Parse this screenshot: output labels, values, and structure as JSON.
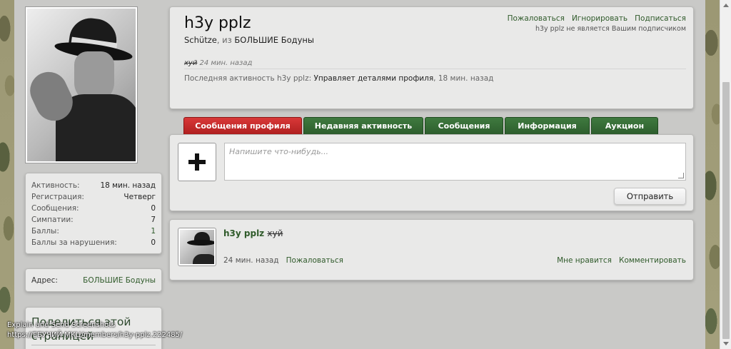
{
  "profile": {
    "username": "h3y pplz",
    "title": "Schütze",
    "from_word": ", из",
    "location": "БОЛЬШИЕ Бодуны",
    "status_text": "хуй",
    "status_time": "24 мин. назад",
    "last_activity_label": "Последняя активность h3y pplz:",
    "last_activity_action": "Управляет деталями профиля",
    "last_activity_time": ", 18 мин. назад",
    "links": {
      "report": "Пожаловаться",
      "ignore": "Игнорировать",
      "follow": "Подписаться"
    },
    "follow_note": "h3y pplz не является Вашим подписчиком"
  },
  "sidebar": {
    "stats": [
      {
        "label": "Активность:",
        "value": "18 мин. назад"
      },
      {
        "label": "Регистрация:",
        "value": "Четверг"
      },
      {
        "label": "Сообщения:",
        "value": "0"
      },
      {
        "label": "Симпатии:",
        "value": "7"
      },
      {
        "label": "Баллы:",
        "value": "1"
      },
      {
        "label": "Баллы за нарушения:",
        "value": "0"
      }
    ],
    "address_label": "Адрес:",
    "address_value": "БОЛЬШИЕ Бодуны",
    "share_title": "Поделиться этой страницей"
  },
  "tabs": [
    {
      "label": "Сообщения профиля",
      "active": true
    },
    {
      "label": "Недавняя активность",
      "active": false
    },
    {
      "label": "Сообщения",
      "active": false
    },
    {
      "label": "Информация",
      "active": false
    },
    {
      "label": "Аукцион",
      "active": false
    }
  ],
  "post_form": {
    "placeholder": "Напишите что-нибудь...",
    "submit_label": "Отправить"
  },
  "message": {
    "author": "h3y pplz",
    "text": "хуй",
    "time": "24 мин. назад",
    "report": "Пожаловаться",
    "like": "Мне нравится",
    "comment": "Комментировать"
  },
  "statusbar": {
    "line1": "Explain and Send Screenshots",
    "line2": "https://ЕБУЧИЙ МКЦ/members/h3y-pplz.222485/"
  }
}
